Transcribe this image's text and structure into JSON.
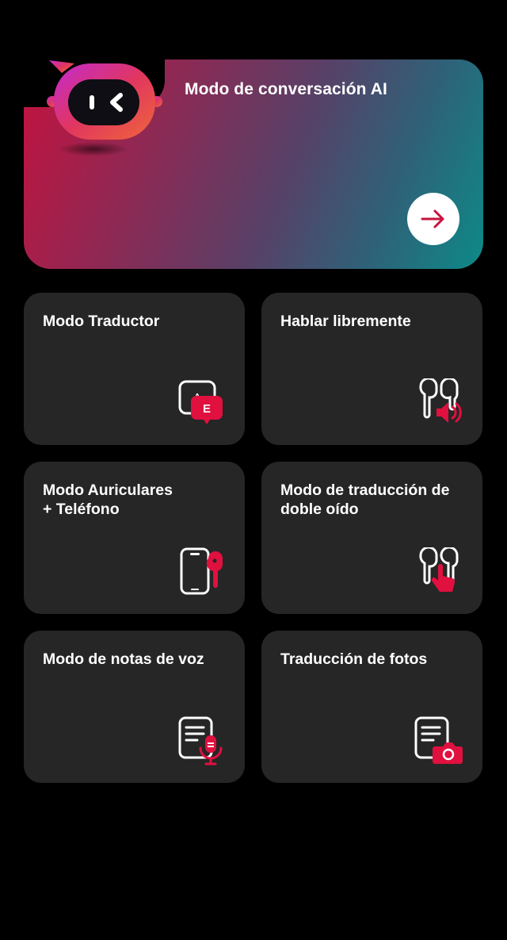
{
  "hero": {
    "title": "Modo de conversación AI",
    "arrow_icon": "arrow-right-icon",
    "robot_icon": "ai-robot-icon"
  },
  "cards": [
    {
      "title": "Modo Traductor",
      "icon": "translate-bubble-icon",
      "icon_letters": [
        "A",
        "E"
      ]
    },
    {
      "title": "Hablar libremente",
      "icon": "earbuds-speaker-icon"
    },
    {
      "title": "Modo Auriculares\n+ Teléfono",
      "icon": "phone-earbud-icon"
    },
    {
      "title": "Modo de traducción de doble oído",
      "icon": "earbuds-touch-icon"
    },
    {
      "title": "Modo de notas de voz",
      "icon": "voice-notes-icon"
    },
    {
      "title": "Traducción de fotos",
      "icon": "photo-translate-icon"
    }
  ],
  "colors": {
    "accent": "#e0103f",
    "card_bg": "#262626",
    "background": "#000000"
  }
}
